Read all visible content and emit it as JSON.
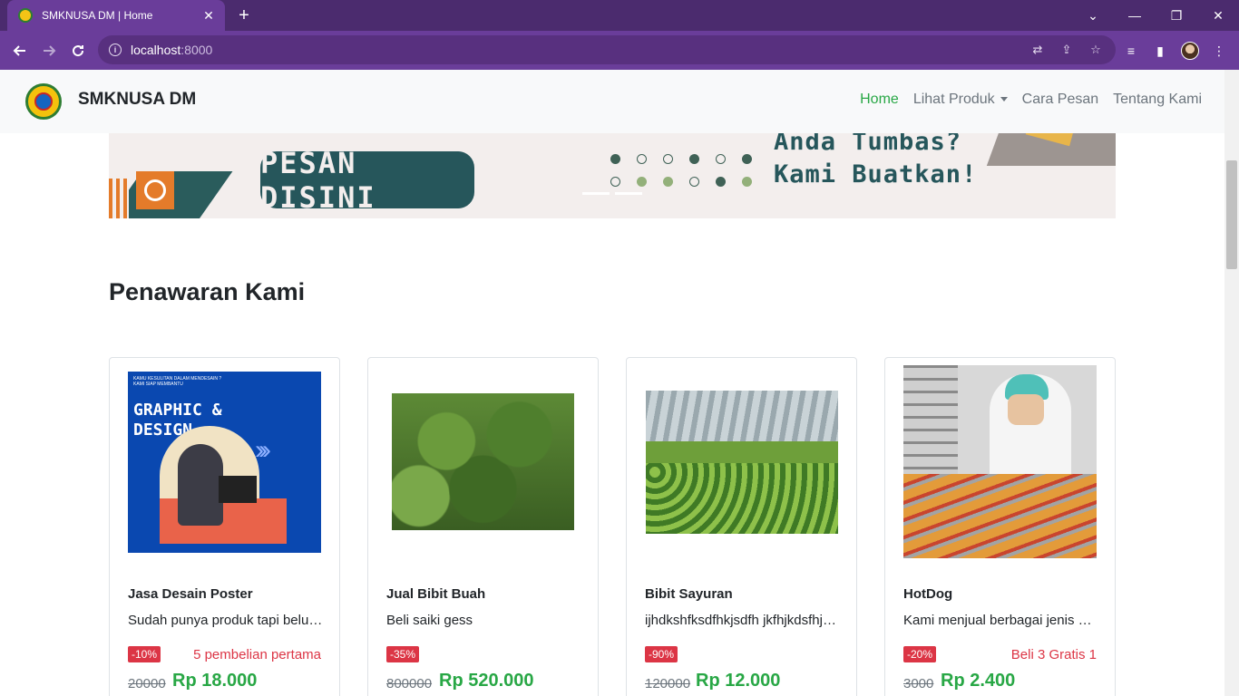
{
  "browser": {
    "tab_title": "SMKNUSA DM | Home",
    "url_host": "localhost",
    "url_port": ":8000"
  },
  "navbar": {
    "brand": "SMKNUSA DM",
    "links": [
      "Home",
      "Lihat Produk",
      "Cara Pesan",
      "Tentang Kami"
    ],
    "active": "Home"
  },
  "banner": {
    "button_text": "PESAN DISINI",
    "tagline_1": "Anda Tumbas?",
    "tagline_2": "Kami Buatkan!"
  },
  "section": {
    "title": "Penawaran Kami"
  },
  "products": [
    {
      "title": "Jasa Desain Poster",
      "desc": "Sudah punya produk tapi belum punya poster?",
      "badge": "-10%",
      "promo": "5 pembelian pertama",
      "old_price": "20000",
      "new_price": "Rp 18.000",
      "image": "poster-graphic-design",
      "poster_heading": "GRAPHIC & DESIGN",
      "poster_subtext": "KAMU KESULITAN DALAM MENDESAIN ? KAMI SIAP MEMBANTU"
    },
    {
      "title": "Jual Bibit Buah",
      "desc": "Beli saiki gess",
      "badge": "-35%",
      "promo": "",
      "old_price": "800000",
      "new_price": "Rp 520.000",
      "image": "fruit-trees"
    },
    {
      "title": "Bibit Sayuran",
      "desc": "ijhdkshfksdfhkjsdfh jkfhjkdsfhjkdsf",
      "badge": "-90%",
      "promo": "",
      "old_price": "120000",
      "new_price": "Rp 12.000",
      "image": "greenhouse"
    },
    {
      "title": "HotDog",
      "desc": "Kami menjual berbagai jenis hotdog",
      "badge": "-20%",
      "promo": "Beli 3 Gratis 1",
      "old_price": "3000",
      "new_price": "Rp 2.400",
      "image": "chef-hotdog"
    }
  ],
  "colors": {
    "browser_frame": "#6a3d9a",
    "tab_strip": "#4b2b6e",
    "active_link": "#28a745",
    "price": "#28a745",
    "badge": "#dc3545",
    "promo": "#dc3545"
  }
}
